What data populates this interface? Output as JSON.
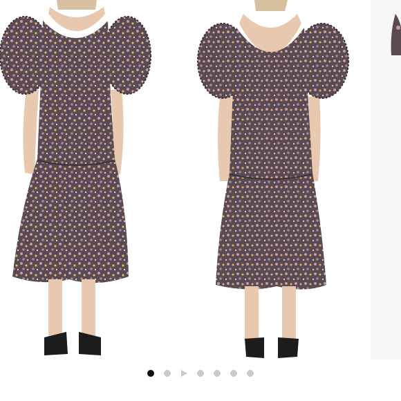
{
  "carousel": {
    "slide_count": 7,
    "active_index": 0,
    "slides": [
      {
        "icon": "product-photo-front"
      },
      {
        "icon": "product-photo-back"
      },
      {
        "icon": "product-photo-partial"
      }
    ]
  },
  "pager": {
    "items": [
      {
        "type": "dot",
        "active": true
      },
      {
        "type": "dot",
        "active": false
      },
      {
        "type": "play",
        "icon": "play-icon"
      },
      {
        "type": "dot",
        "active": false
      },
      {
        "type": "dot",
        "active": false
      },
      {
        "type": "dot",
        "active": false
      },
      {
        "type": "dot",
        "active": false
      }
    ],
    "colors": {
      "active": "#111111",
      "inactive": "#c9c9c9"
    }
  },
  "colors": {
    "dress_base": "#5a4a52",
    "dress_dark": "#3e3138",
    "floral_pink": "#c89aa8",
    "floral_yellow": "#d8b870",
    "skin": "#e8c9b0",
    "shoe": "#1c1c1c",
    "background": "#ffffff"
  }
}
